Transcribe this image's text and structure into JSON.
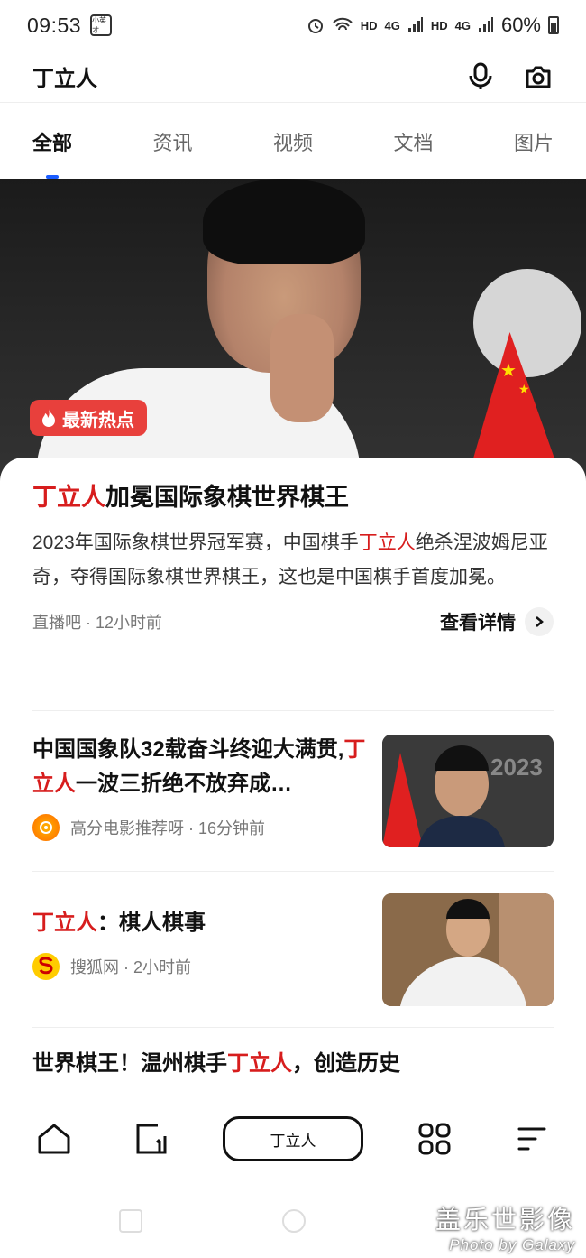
{
  "status_bar": {
    "time": "09:53",
    "notification_label": "小英才",
    "network_labels": [
      "HD",
      "4G",
      "HD",
      "4G"
    ],
    "battery": "60%"
  },
  "header": {
    "query": "丁立人",
    "mic_icon": "microphone-icon",
    "camera_icon": "camera-icon"
  },
  "tabs": [
    {
      "label": "全部",
      "active": true
    },
    {
      "label": "资讯",
      "active": false
    },
    {
      "label": "视频",
      "active": false
    },
    {
      "label": "文档",
      "active": false
    },
    {
      "label": "图片",
      "active": false
    }
  ],
  "hero": {
    "badge": "最新热点"
  },
  "featured": {
    "title_highlight": "丁立人",
    "title_rest": "加冕国际象棋世界棋王",
    "body_part1": "2023年国际象棋世界冠军赛，中国棋手",
    "body_highlight": "丁立人",
    "body_part2": "绝杀涅波姆尼亚奇，夺得国际象棋世界棋王，这也是中国棋手首度加冕。",
    "source": "直播吧 · 12小时前",
    "details_label": "查看详情"
  },
  "articles": [
    {
      "title_part1": "中国国象队32载奋斗终迎大满贯,",
      "title_highlight": "丁立人",
      "title_part2": "一波三折绝不放弃成…",
      "source": "高分电影推荐呀 · 16分钟前"
    },
    {
      "title_part1": "",
      "title_highlight": "丁立人",
      "title_part2": "：棋人棋事",
      "source": "搜狐网 · 2小时前"
    },
    {
      "title_part1": "世界棋王！温州棋手",
      "title_highlight": "丁立人",
      "title_part2": "，创造历史"
    }
  ],
  "bottom_nav": {
    "search_label": "丁立人"
  },
  "watermark": {
    "line1": "盖乐世影像",
    "line2": "Photo by Galaxy"
  },
  "colors": {
    "highlight": "#d71d1d",
    "accent": "#1a5cff",
    "badge": "#e8403c"
  }
}
